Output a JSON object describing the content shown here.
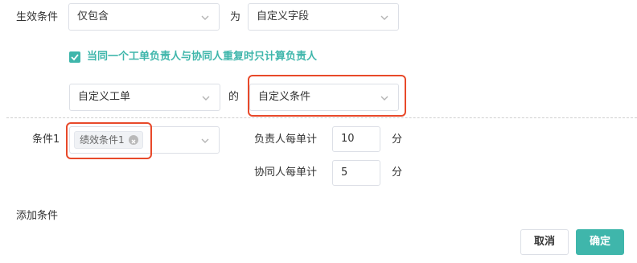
{
  "rule": {
    "label": "生效条件",
    "scope_select": "仅包含",
    "as_label": "为",
    "field_select": "自定义字段"
  },
  "option": {
    "checked": true,
    "text": "当同一个工单负责人与协同人重复时只计算负责人"
  },
  "source": {
    "ticket_select": "自定义工单",
    "of_label": "的",
    "condition_select": "自定义条件"
  },
  "condition1": {
    "label": "条件1",
    "tag": "绩效条件1",
    "owner_label": "负责人每单计",
    "owner_value": "10",
    "owner_unit": "分",
    "collab_label": "协同人每单计",
    "collab_value": "5",
    "collab_unit": "分"
  },
  "add_condition": "添加条件",
  "buttons": {
    "cancel": "取消",
    "ok": "确定"
  },
  "colors": {
    "accent": "#3fb6ab",
    "highlight": "#e8492a"
  }
}
